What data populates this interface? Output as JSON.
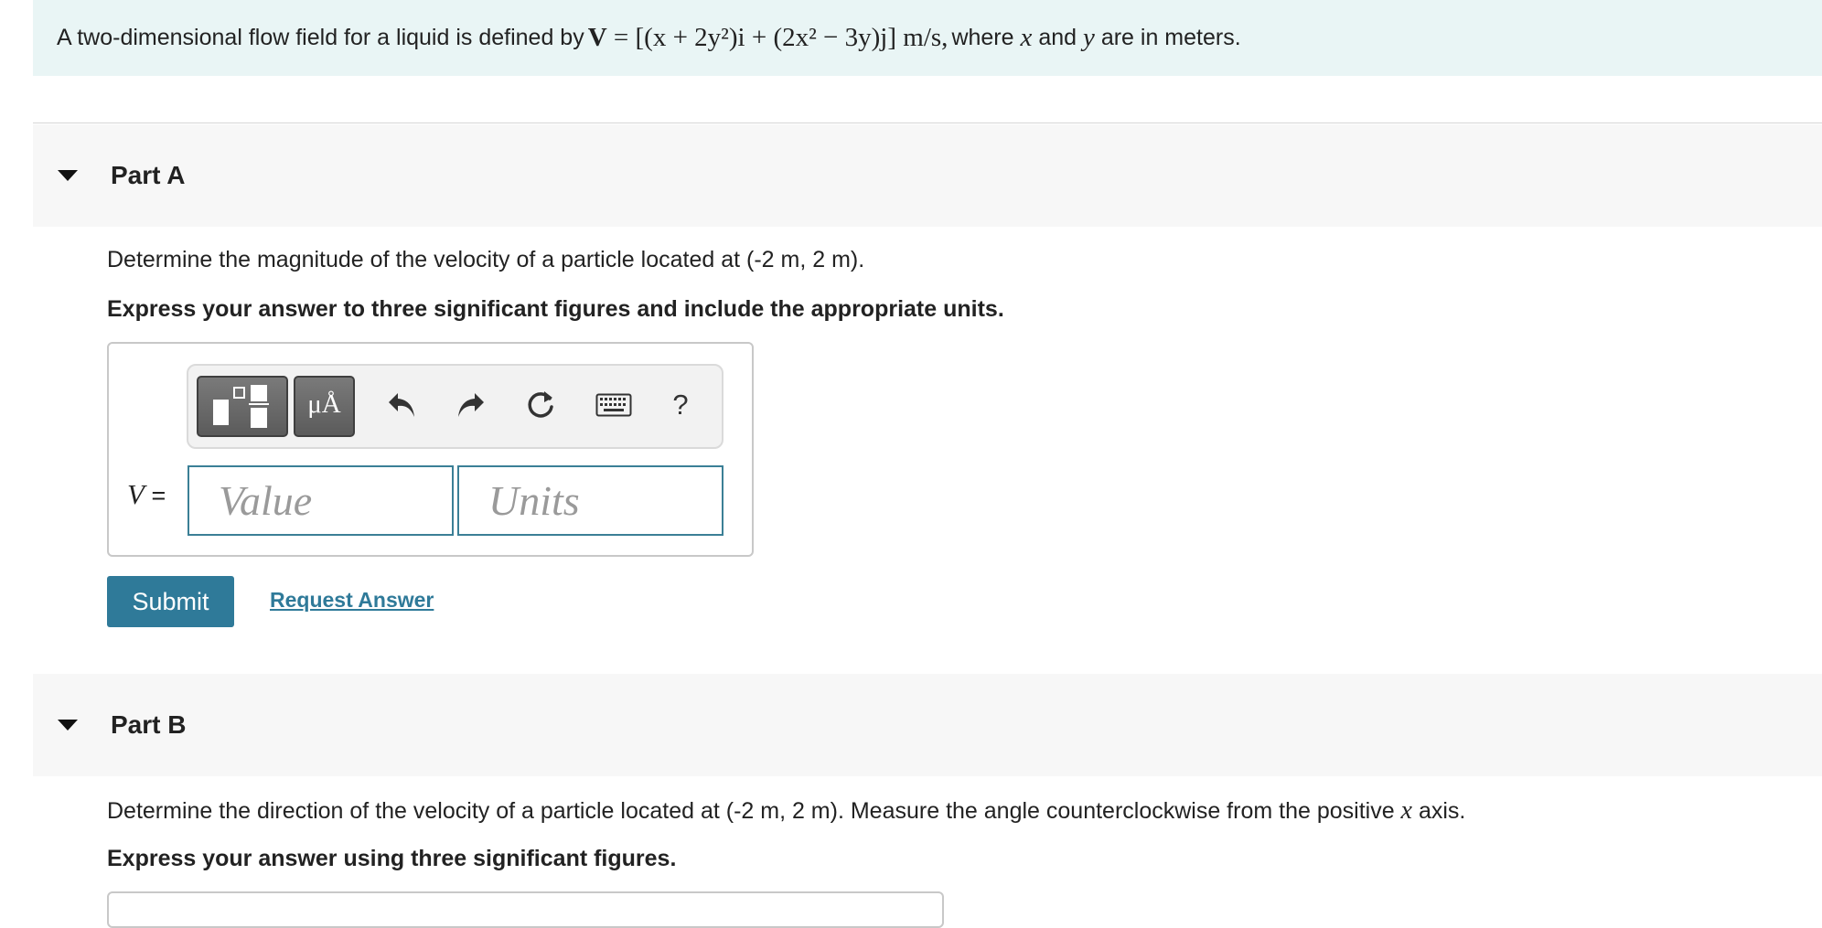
{
  "intro": {
    "lead": "A two-dimensional flow field for a liquid is defined by",
    "equation_vector": "V",
    "equation_rhs": "= [(x + 2y²)i + (2x² − 3y)j] m/s,",
    "mid": "where",
    "var_x": "x",
    "and": "and",
    "var_y": "y",
    "tail": "are in meters."
  },
  "partA": {
    "title": "Part A",
    "question_text": "Determine the magnitude of the velocity of a particle located at (-2 m, 2 m).",
    "instruction": "Express your answer to three significant figures and include the appropriate units.",
    "toolbar": {
      "units_label": "μÅ",
      "help_label": "?"
    },
    "equation_label_var": "V",
    "equation_label_eq": "=",
    "value_placeholder": "Value",
    "units_placeholder": "Units",
    "submit_label": "Submit",
    "request_label": "Request Answer"
  },
  "partB": {
    "title": "Part B",
    "question_text": "Determine the direction of the velocity of a particle located at (-2 m, 2 m). Measure the angle counterclockwise from the positive",
    "question_var": "x",
    "question_tail": "axis.",
    "instruction": "Express your answer using three significant figures."
  },
  "colors": {
    "intro_background": "#e9f5f5",
    "part_header_background": "#f7f7f7",
    "accent": "#2f7a99",
    "field_border": "#3b7f96"
  }
}
